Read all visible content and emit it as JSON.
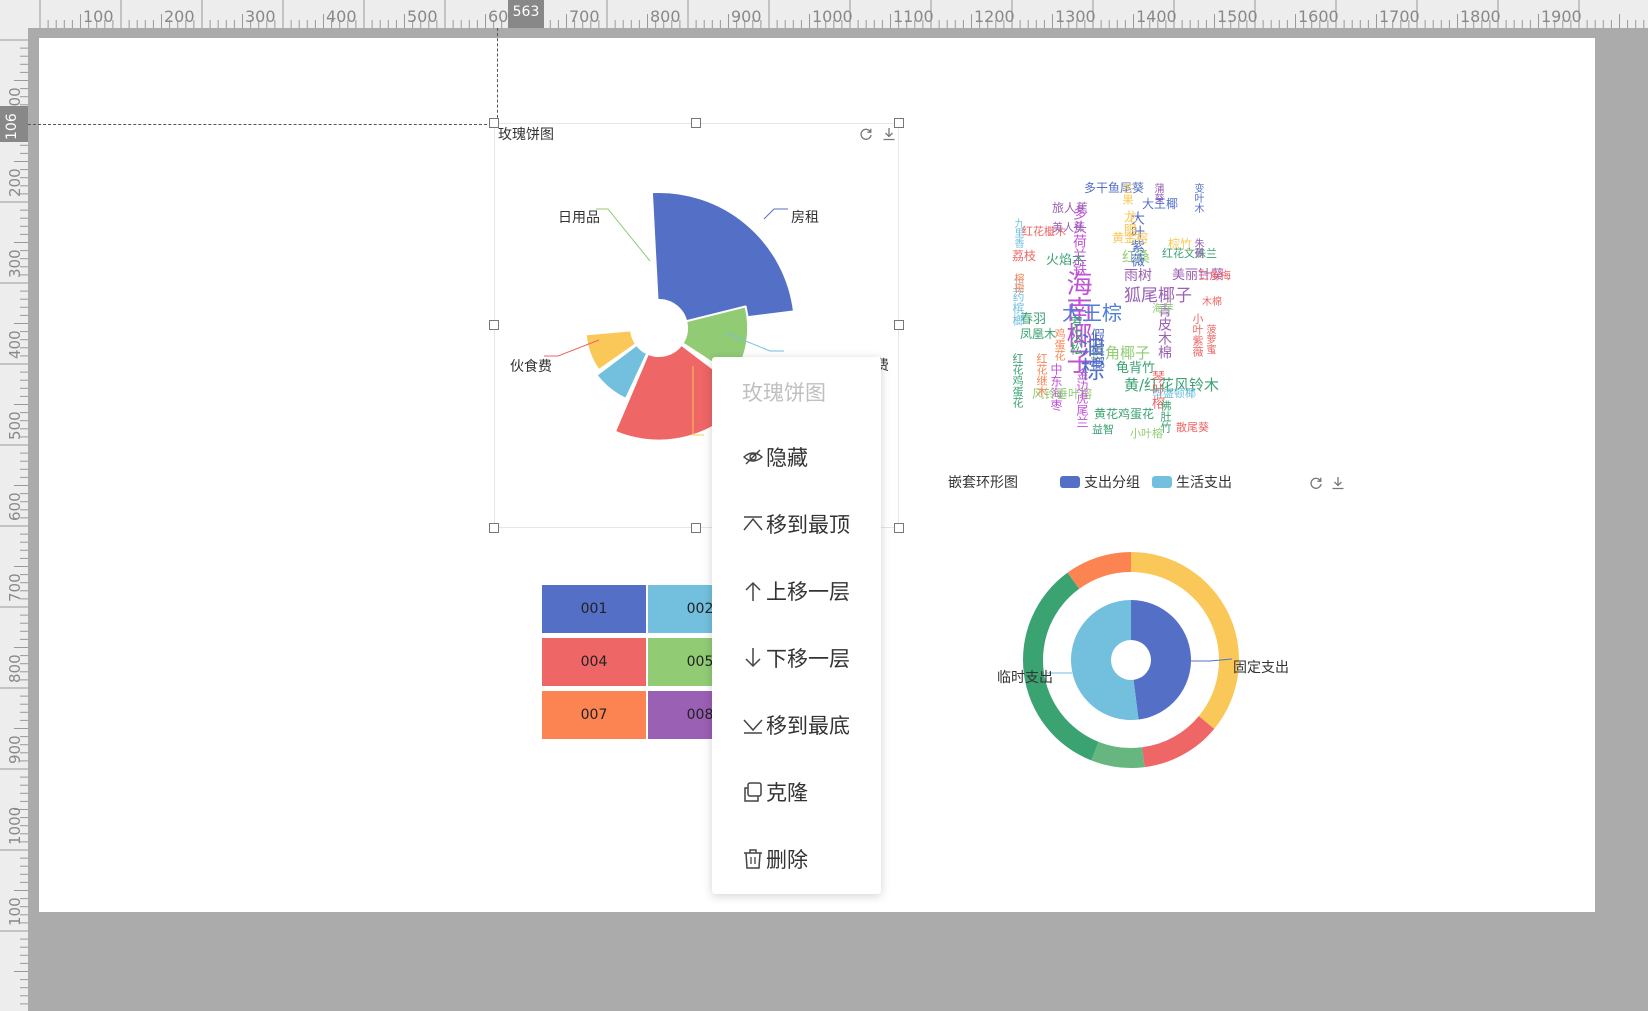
{
  "ruler": {
    "top_labels": [
      "100",
      "200",
      "300",
      "400",
      "500",
      "600",
      "700",
      "800",
      "900",
      "1000",
      "1100",
      "1200",
      "1300",
      "1400",
      "1500",
      "1600",
      "1700",
      "1800",
      "1900"
    ],
    "left_labels": [
      "100",
      "200",
      "300",
      "400",
      "500",
      "600",
      "700",
      "800",
      "900",
      "1000",
      "100"
    ],
    "top_marker": "563",
    "left_marker": "106"
  },
  "rose_chart": {
    "title": "玫瑰饼图",
    "labels": {
      "rent": "房租",
      "daily": "日用品",
      "food": "伙食费",
      "partial": "费"
    },
    "chart_data": {
      "type": "pie",
      "subtype": "rose",
      "title": "玫瑰饼图",
      "categories": [
        "房租",
        "日用品",
        "伙食费",
        "",
        ""
      ],
      "values": [
        5,
        2,
        3.5,
        1.3,
        1
      ],
      "colors": [
        "#5470c6",
        "#91cc75",
        "#ee6666",
        "#73c0de",
        "#fac858"
      ]
    }
  },
  "table_grid": {
    "cells": [
      "001",
      "002",
      "004",
      "005",
      "007",
      "008"
    ],
    "colors": [
      "#5470c6",
      "#73c0de",
      "#ee6666",
      "#91cc75",
      "#fc8452",
      "#9a60b4"
    ]
  },
  "wordcloud": {
    "words": [
      {
        "t": "海南椰子",
        "c": "#c052d6"
      },
      {
        "t": "油棕",
        "c": "#5470c6"
      },
      {
        "t": "大王棕",
        "c": "#4f7fd6"
      },
      {
        "t": "狐尾椰子",
        "c": "#9a60b4"
      },
      {
        "t": "三角椰子",
        "c": "#91cc75"
      },
      {
        "t": "黄/红花风铃木",
        "c": "#3ba272"
      },
      {
        "t": "青皮木棉",
        "c": "#9a60b4"
      },
      {
        "t": "红桑",
        "c": "#91cc75"
      },
      {
        "t": "雨树",
        "c": "#9a60b4"
      },
      {
        "t": "美丽针葵",
        "c": "#9a60b4"
      },
      {
        "t": "火焰木",
        "c": "#3ba272"
      },
      {
        "t": "多头荷兰铁",
        "c": "#c052d6"
      },
      {
        "t": "大叶紫薇",
        "c": "#5470c6"
      },
      {
        "t": "春羽",
        "c": "#3ba272"
      },
      {
        "t": "罗汉松",
        "c": "#3ba272"
      },
      {
        "t": "龟背竹",
        "c": "#3ba272"
      },
      {
        "t": "琴叶榕",
        "c": "#ee6666"
      },
      {
        "t": "荔枝",
        "c": "#ee6666"
      },
      {
        "t": "凤凰木",
        "c": "#3ba272"
      },
      {
        "t": "棕竹",
        "c": "#fac858"
      },
      {
        "t": "多干鱼尾葵",
        "c": "#5470c6"
      },
      {
        "t": "旅人蕉",
        "c": "#9a60b4"
      },
      {
        "t": "龙眼",
        "c": "#fac858"
      },
      {
        "t": "中东海枣",
        "c": "#c052d6"
      },
      {
        "t": "风铃垂叶榕",
        "c": "#91cc75"
      },
      {
        "t": "黄花鸡蛋花",
        "c": "#3ba272"
      },
      {
        "t": "益智",
        "c": "#3ba272"
      },
      {
        "t": "小叶榕",
        "c": "#91cc75"
      },
      {
        "t": "散尾葵",
        "c": "#ee6666"
      },
      {
        "t": "假槟榔",
        "c": "#5470c6"
      },
      {
        "t": "三药槟榔",
        "c": "#73c0de"
      },
      {
        "t": "红花鸡蛋花",
        "c": "#3ba272"
      },
      {
        "t": "九里香",
        "c": "#73c0de"
      },
      {
        "t": "红花继木",
        "c": "#fc8452"
      },
      {
        "t": "金边虎尾兰",
        "c": "#c052d6"
      },
      {
        "t": "海芋",
        "c": "#91cc75"
      },
      {
        "t": "华盛顿椰",
        "c": "#73c0de"
      },
      {
        "t": "佛肚竹",
        "c": "#3ba272"
      },
      {
        "t": "黄金榕",
        "c": "#fac858"
      },
      {
        "t": "鸡蛋花",
        "c": "#fc8452"
      },
      {
        "t": "红花檵木",
        "c": "#ee6666"
      },
      {
        "t": "小叶紫薇",
        "c": "#ee6666"
      },
      {
        "t": "美人蕉",
        "c": "#9a60b4"
      },
      {
        "t": "芒果",
        "c": "#fac858"
      },
      {
        "t": "菠萝蜜",
        "c": "#ee6666"
      },
      {
        "t": "木棉",
        "c": "#ee6666"
      },
      {
        "t": "三角梅",
        "c": "#ee6666"
      },
      {
        "t": "红花文殊兰",
        "c": "#3ba272"
      },
      {
        "t": "变叶木",
        "c": "#5470c6"
      },
      {
        "t": "榕树",
        "c": "#fc8452"
      },
      {
        "t": "蒲葵",
        "c": "#9a60b4"
      },
      {
        "t": "朱蕉",
        "c": "#9a60b4"
      },
      {
        "t": "大王椰",
        "c": "#5470c6"
      }
    ]
  },
  "nested_donut": {
    "title": "嵌套环形图",
    "legend": [
      {
        "label": "支出分组",
        "color": "#5470c6"
      },
      {
        "label": "生活支出",
        "color": "#73c0de"
      }
    ],
    "labels": {
      "fixed": "固定支出",
      "temporary": "临时支出"
    },
    "chart_data": {
      "type": "pie",
      "subtype": "nested-donut",
      "title": "嵌套环形图",
      "series": [
        {
          "name": "支出分组",
          "categories": [
            "固定支出",
            "临时支出"
          ],
          "values": [
            48,
            52
          ],
          "colors": [
            "#5470c6",
            "#73c0de"
          ]
        },
        {
          "name": "生活支出",
          "categories": [
            "",
            "",
            "",
            "",
            ""
          ],
          "values": [
            36,
            12,
            8,
            34,
            10
          ],
          "colors": [
            "#fac858",
            "#ee6666",
            "#67b67f",
            "#3ba272",
            "#fc8452"
          ]
        }
      ]
    }
  },
  "context_menu": {
    "title": "玫瑰饼图",
    "items": [
      {
        "label": "隐藏",
        "icon": "eye-slash-icon"
      },
      {
        "label": "移到最顶",
        "icon": "move-top-icon"
      },
      {
        "label": "上移一层",
        "icon": "arrow-up-icon"
      },
      {
        "label": "下移一层",
        "icon": "arrow-down-icon"
      },
      {
        "label": "移到最底",
        "icon": "move-bottom-icon"
      },
      {
        "label": "克隆",
        "icon": "copy-icon"
      },
      {
        "label": "删除",
        "icon": "trash-icon"
      }
    ]
  }
}
